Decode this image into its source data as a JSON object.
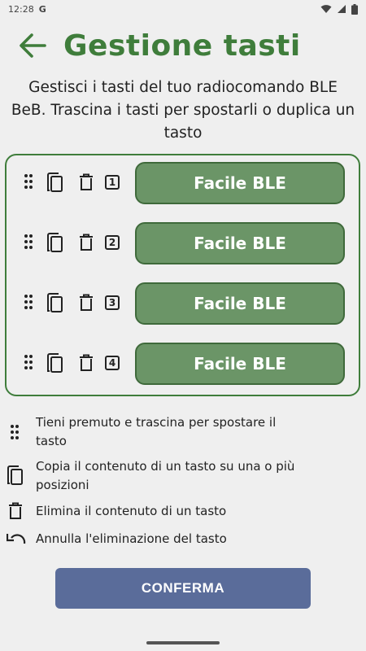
{
  "status_bar": {
    "time": "12:28",
    "carrier_glyph": "G"
  },
  "header": {
    "title": "Gestione tasti"
  },
  "description": "Gestisci i tasti del tuo radiocomando BLE BeB. Trascina i tasti per spostarli o duplica un tasto",
  "keys": [
    {
      "number": "1",
      "label": "Facile BLE"
    },
    {
      "number": "2",
      "label": "Facile BLE"
    },
    {
      "number": "3",
      "label": "Facile BLE"
    },
    {
      "number": "4",
      "label": "Facile BLE"
    }
  ],
  "legend": [
    {
      "icon": "drag-handle-icon",
      "text": "Tieni premuto e trascina per spostare il tasto"
    },
    {
      "icon": "copy-icon",
      "text": "Copia il contenuto di un tasto su una o più posizioni"
    },
    {
      "icon": "trash-icon",
      "text": "Elimina il contenuto di un tasto"
    },
    {
      "icon": "undo-icon",
      "text": "Annulla l'eliminazione del tasto"
    }
  ],
  "confirm_label": "CONFERMA",
  "colors": {
    "accent": "#3f7d3b",
    "key_fill": "#6b9567",
    "confirm": "#5a6c9a"
  }
}
